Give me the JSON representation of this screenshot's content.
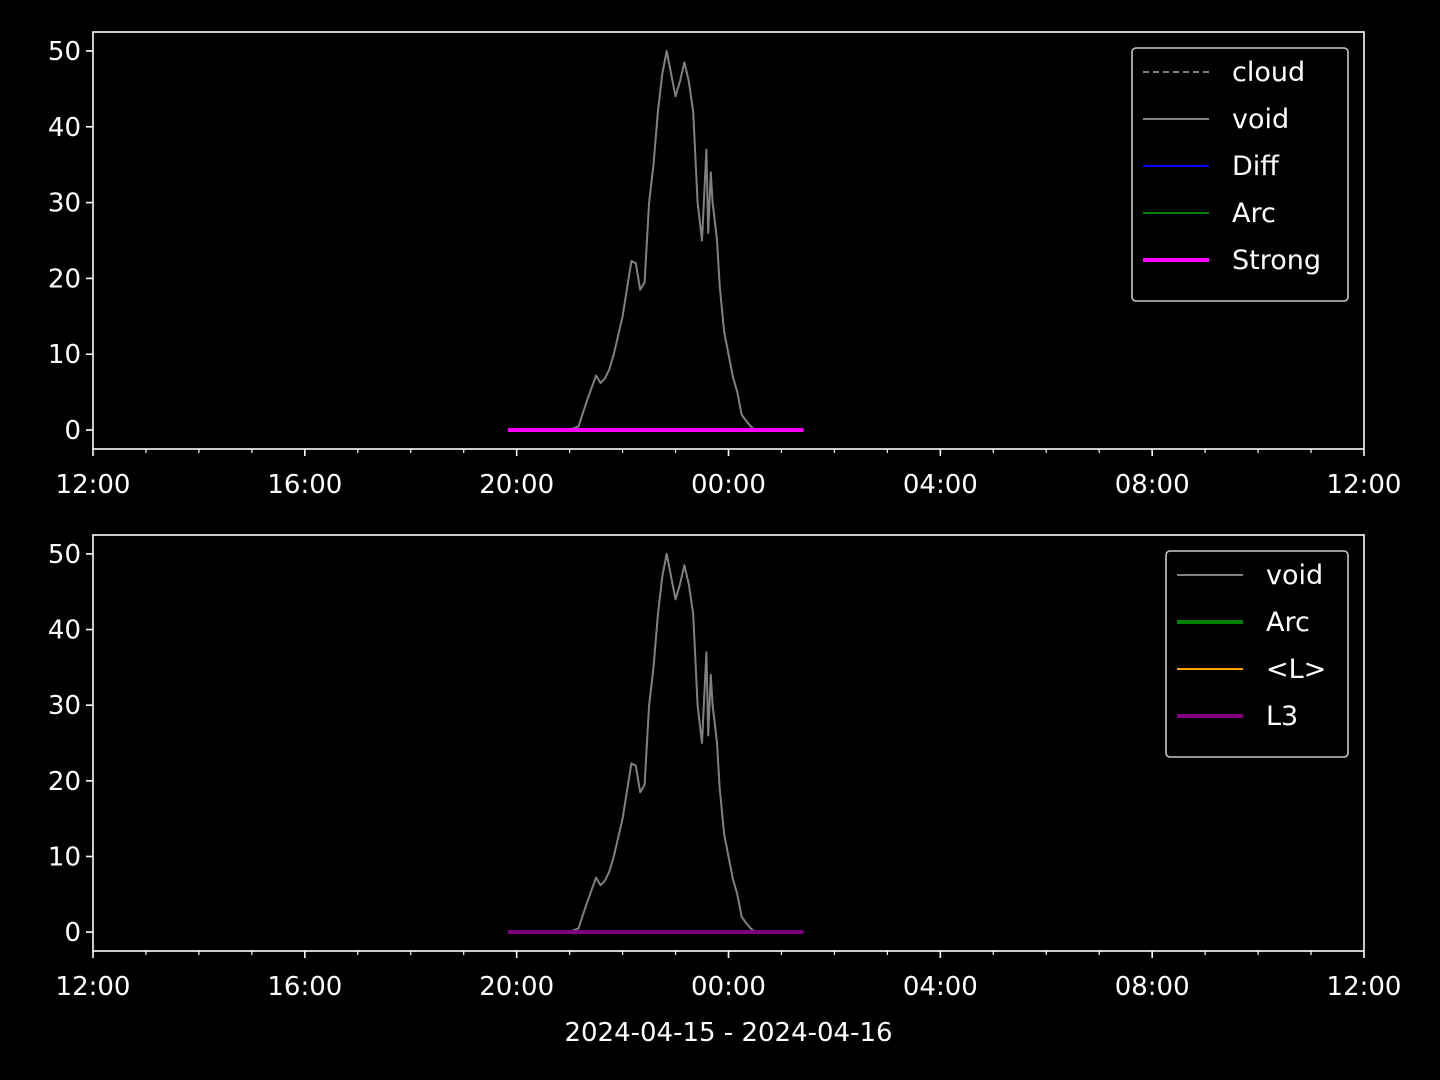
{
  "chart_data": [
    {
      "type": "line",
      "title": "",
      "xlabel": "",
      "ylabel": "",
      "xlim": [
        "2024-04-15 12:00",
        "2024-04-16 12:00"
      ],
      "ylim": [
        -2.5,
        52.5
      ],
      "x_ticks": [
        "12:00",
        "16:00",
        "20:00",
        "00:00",
        "04:00",
        "08:00",
        "12:00"
      ],
      "y_ticks": [
        0,
        10,
        20,
        30,
        40,
        50
      ],
      "grid": false,
      "legend_position": "top-right",
      "series": [
        {
          "name": "cloud",
          "color": "#808080",
          "style": "dashed",
          "x": [],
          "y": []
        },
        {
          "name": "void",
          "color": "#808080",
          "style": "solid",
          "x": [
            "2024-04-15 21:00",
            "2024-04-15 21:10",
            "2024-04-15 21:20",
            "2024-04-15 21:30",
            "2024-04-15 21:35",
            "2024-04-15 21:40",
            "2024-04-15 21:45",
            "2024-04-15 21:50",
            "2024-04-15 22:00",
            "2024-04-15 22:10",
            "2024-04-15 22:15",
            "2024-04-15 22:20",
            "2024-04-15 22:25",
            "2024-04-15 22:30",
            "2024-04-15 22:35",
            "2024-04-15 22:40",
            "2024-04-15 22:45",
            "2024-04-15 22:50",
            "2024-04-15 23:00",
            "2024-04-15 23:05",
            "2024-04-15 23:10",
            "2024-04-15 23:15",
            "2024-04-15 23:20",
            "2024-04-15 23:25",
            "2024-04-15 23:30",
            "2024-04-15 23:35",
            "2024-04-15 23:37",
            "2024-04-15 23:40",
            "2024-04-15 23:42",
            "2024-04-15 23:45",
            "2024-04-15 23:47",
            "2024-04-15 23:50",
            "2024-04-15 23:55",
            "2024-04-16 00:00",
            "2024-04-16 00:05",
            "2024-04-16 00:10",
            "2024-04-16 00:15",
            "2024-04-16 00:20",
            "2024-04-16 00:25",
            "2024-04-16 00:30"
          ],
          "y": [
            0,
            0.5,
            4,
            7.2,
            6.2,
            6.8,
            8,
            10,
            15,
            22.3,
            22,
            18.5,
            19.5,
            30,
            35,
            42,
            47,
            50,
            44,
            46,
            48.5,
            46,
            42,
            30,
            25,
            37,
            26,
            34,
            30,
            27,
            25,
            19,
            13,
            10,
            7,
            5,
            2,
            1.2,
            0.5,
            0
          ]
        },
        {
          "name": "Diff",
          "color": "#0000ff",
          "style": "solid",
          "x": [],
          "y": []
        },
        {
          "name": "Arc",
          "color": "#008000",
          "style": "solid",
          "x": [],
          "y": []
        },
        {
          "name": "Strong",
          "color": "#ff00ff",
          "style": "solid-thick",
          "x": [
            "2024-04-15 19:50",
            "2024-04-16 01:25"
          ],
          "y": [
            0,
            0
          ]
        }
      ]
    },
    {
      "type": "line",
      "title": "",
      "xlabel": "2024-04-15 - 2024-04-16",
      "ylabel": "",
      "xlim": [
        "2024-04-15 12:00",
        "2024-04-16 12:00"
      ],
      "ylim": [
        -2.5,
        52.5
      ],
      "x_ticks": [
        "12:00",
        "16:00",
        "20:00",
        "00:00",
        "04:00",
        "08:00",
        "12:00"
      ],
      "y_ticks": [
        0,
        10,
        20,
        30,
        40,
        50
      ],
      "grid": false,
      "legend_position": "top-right",
      "series": [
        {
          "name": "void",
          "color": "#808080",
          "style": "solid",
          "x": [
            "2024-04-15 21:00",
            "2024-04-15 21:10",
            "2024-04-15 21:20",
            "2024-04-15 21:30",
            "2024-04-15 21:35",
            "2024-04-15 21:40",
            "2024-04-15 21:45",
            "2024-04-15 21:50",
            "2024-04-15 22:00",
            "2024-04-15 22:10",
            "2024-04-15 22:15",
            "2024-04-15 22:20",
            "2024-04-15 22:25",
            "2024-04-15 22:30",
            "2024-04-15 22:35",
            "2024-04-15 22:40",
            "2024-04-15 22:45",
            "2024-04-15 22:50",
            "2024-04-15 23:00",
            "2024-04-15 23:05",
            "2024-04-15 23:10",
            "2024-04-15 23:15",
            "2024-04-15 23:20",
            "2024-04-15 23:25",
            "2024-04-15 23:30",
            "2024-04-15 23:35",
            "2024-04-15 23:37",
            "2024-04-15 23:40",
            "2024-04-15 23:42",
            "2024-04-15 23:45",
            "2024-04-15 23:47",
            "2024-04-15 23:50",
            "2024-04-15 23:55",
            "2024-04-16 00:00",
            "2024-04-16 00:05",
            "2024-04-16 00:10",
            "2024-04-16 00:15",
            "2024-04-16 00:20",
            "2024-04-16 00:25",
            "2024-04-16 00:30"
          ],
          "y": [
            0,
            0.5,
            4,
            7.2,
            6.2,
            6.8,
            8,
            10,
            15,
            22.3,
            22,
            18.5,
            19.5,
            30,
            35,
            42,
            47,
            50,
            44,
            46,
            48.5,
            46,
            42,
            30,
            25,
            37,
            26,
            34,
            30,
            27,
            25,
            19,
            13,
            10,
            7,
            5,
            2,
            1.2,
            0.5,
            0
          ]
        },
        {
          "name": "Arc",
          "color": "#008000",
          "style": "solid-thick",
          "x": [],
          "y": []
        },
        {
          "name": "<L>",
          "color": "#ffa500",
          "style": "solid",
          "x": [],
          "y": []
        },
        {
          "name": "L3",
          "color": "#800080",
          "style": "solid-thick",
          "x": [
            "2024-04-15 19:50",
            "2024-04-16 01:25"
          ],
          "y": [
            0,
            0
          ]
        }
      ]
    }
  ]
}
